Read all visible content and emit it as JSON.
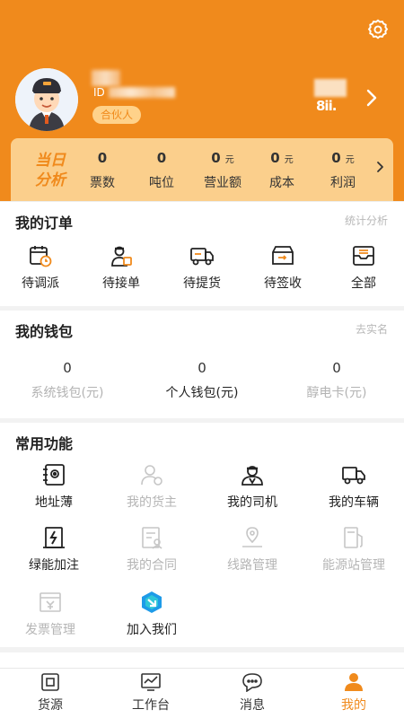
{
  "colors": {
    "brand": "#f08a1c",
    "badge_bg": "#ffd28a",
    "stats_bg": "#fbcf8c",
    "muted": "#b5b5b5"
  },
  "profile": {
    "id_prefix": "ID",
    "role_badge": "合伙人",
    "qr_fragment": "8ii."
  },
  "daily_stats": {
    "title": "当日分析",
    "items": [
      {
        "value": "0",
        "unit": "",
        "label": "票数"
      },
      {
        "value": "0",
        "unit": "",
        "label": "吨位"
      },
      {
        "value": "0",
        "unit": "元",
        "label": "营业额"
      },
      {
        "value": "0",
        "unit": "元",
        "label": "成本"
      },
      {
        "value": "0",
        "unit": "元",
        "label": "利润"
      }
    ]
  },
  "orders": {
    "title": "我的订单",
    "link": "统计分析",
    "items": [
      {
        "label": "待调派",
        "icon": "calendar-clock-icon"
      },
      {
        "label": "待接单",
        "icon": "driver-receive-icon"
      },
      {
        "label": "待提货",
        "icon": "truck-icon"
      },
      {
        "label": "待签收",
        "icon": "box-sign-icon"
      },
      {
        "label": "全部",
        "icon": "inbox-icon"
      }
    ]
  },
  "wallet": {
    "title": "我的钱包",
    "link": "去实名",
    "items": [
      {
        "value": "0",
        "label": "系统钱包(元)"
      },
      {
        "value": "0",
        "label": "个人钱包(元)"
      },
      {
        "value": "0",
        "label": "醇电卡(元)"
      }
    ]
  },
  "functions": {
    "title": "常用功能",
    "items": [
      {
        "label": "地址薄",
        "icon": "address-book-icon"
      },
      {
        "label": "我的货主",
        "icon": "shipper-icon"
      },
      {
        "label": "我的司机",
        "icon": "driver-icon"
      },
      {
        "label": "我的车辆",
        "icon": "vehicle-icon"
      },
      {
        "label": "绿能加注",
        "icon": "green-energy-icon"
      },
      {
        "label": "我的合同",
        "icon": "contract-icon"
      },
      {
        "label": "线路管理",
        "icon": "route-icon"
      },
      {
        "label": "能源站管理",
        "icon": "energy-station-icon"
      },
      {
        "label": "发票管理",
        "icon": "invoice-icon"
      },
      {
        "label": "加入我们",
        "icon": "join-us-icon"
      }
    ]
  },
  "tabbar": {
    "items": [
      {
        "label": "货源",
        "icon": "cargo-source-icon"
      },
      {
        "label": "工作台",
        "icon": "workbench-icon"
      },
      {
        "label": "消息",
        "icon": "message-icon"
      },
      {
        "label": "我的",
        "icon": "profile-icon"
      }
    ]
  }
}
